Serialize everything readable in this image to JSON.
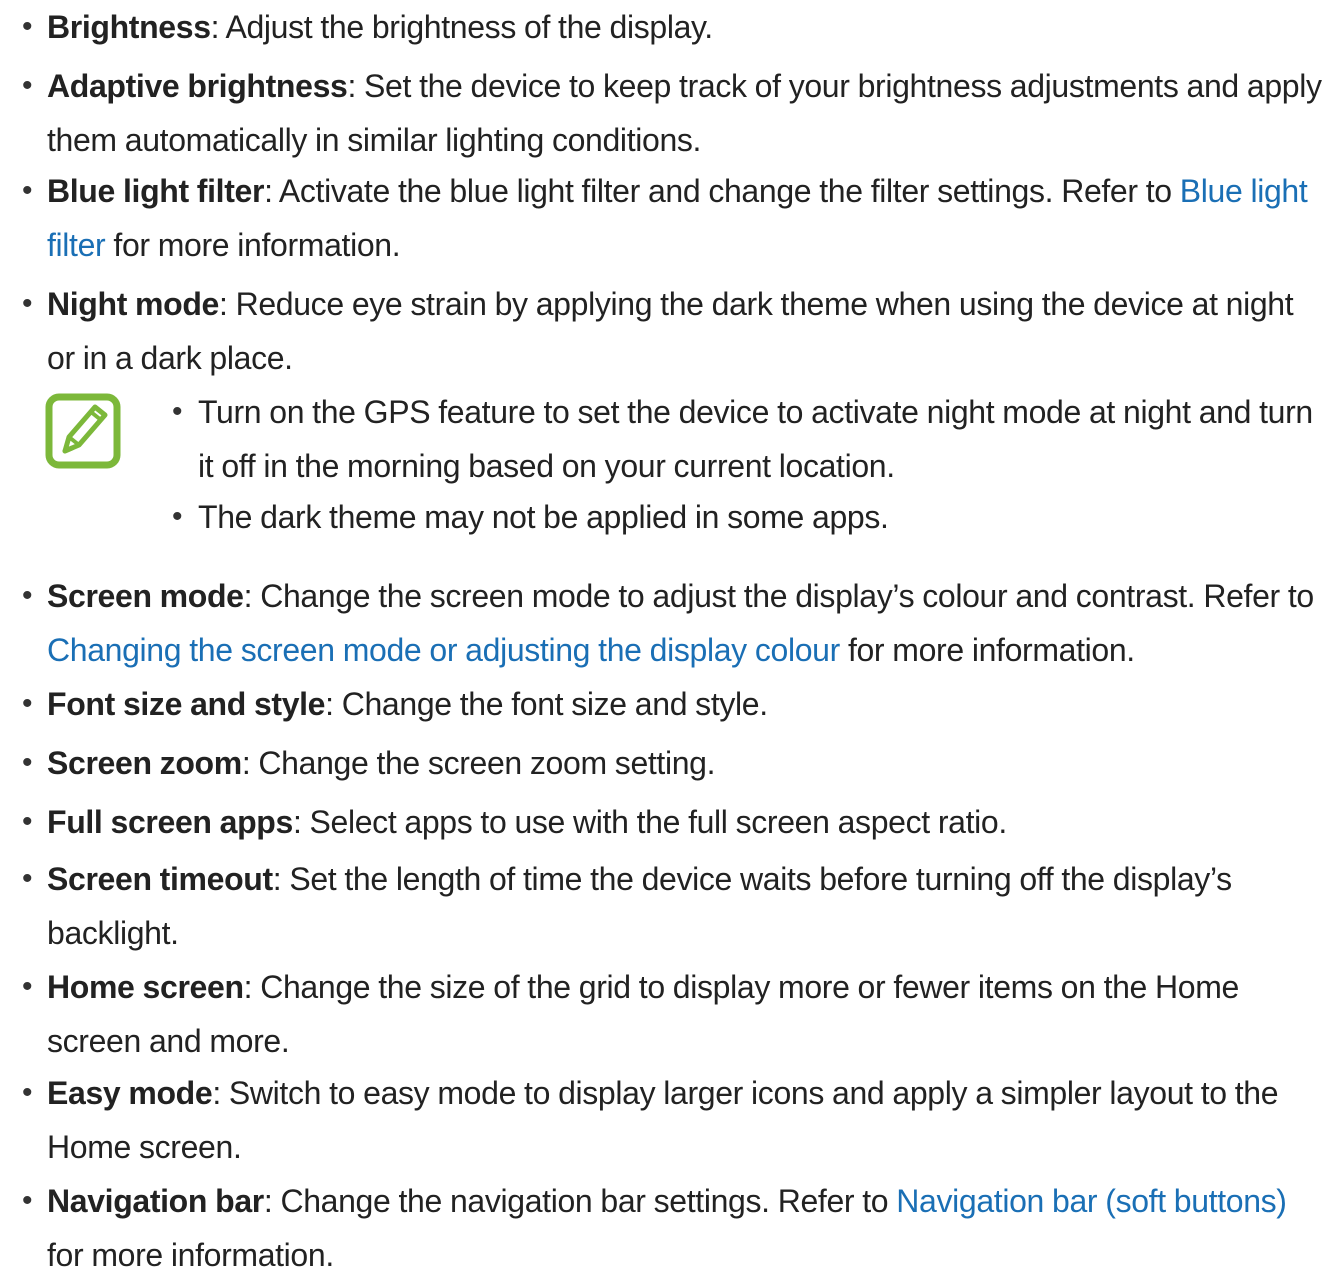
{
  "bullet_glyph": "•",
  "link_color": "#1a6fb5",
  "icon_color": "#7cb83a",
  "items": [
    {
      "label": "Brightness",
      "desc": ": Adjust the brightness of the display."
    },
    {
      "label": "Adaptive brightness",
      "desc": ": Set the device to keep track of your brightness adjustments and apply them automatically in similar lighting conditions."
    },
    {
      "label": "Blue light filter",
      "desc": ": Activate the blue light filter and change the filter settings. Refer to ",
      "link": "Blue light filter",
      "after": " for more information."
    },
    {
      "label": "Night mode",
      "desc": ": Reduce eye strain by applying the dark theme when using the device at night or in a dark place."
    },
    {
      "label": "Screen mode",
      "desc": ": Change the screen mode to adjust the display’s colour and contrast. Refer to ",
      "link": "Changing the screen mode or adjusting the display colour",
      "after": " for more information."
    },
    {
      "label": "Font size and style",
      "desc": ": Change the font size and style."
    },
    {
      "label": "Screen zoom",
      "desc": ": Change the screen zoom setting."
    },
    {
      "label": "Full screen apps",
      "desc": ": Select apps to use with the full screen aspect ratio."
    },
    {
      "label": "Screen timeout",
      "desc": ": Set the length of time the device waits before turning off the display’s backlight."
    },
    {
      "label": "Home screen",
      "desc": ": Change the size of the grid to display more or fewer items on the Home screen and more."
    },
    {
      "label": "Easy mode",
      "desc": ": Switch to easy mode to display larger icons and apply a simpler layout to the Home screen."
    },
    {
      "label": "Navigation bar",
      "desc": ": Change the navigation bar settings. Refer to ",
      "link": "Navigation bar (soft buttons)",
      "after": " for more information."
    }
  ],
  "note": {
    "icon": "note-pencil-icon",
    "items": [
      "Turn on the GPS feature to set the device to activate night mode at night and turn it off in the morning based on your current location.",
      "The dark theme may not be applied in some apps."
    ]
  }
}
